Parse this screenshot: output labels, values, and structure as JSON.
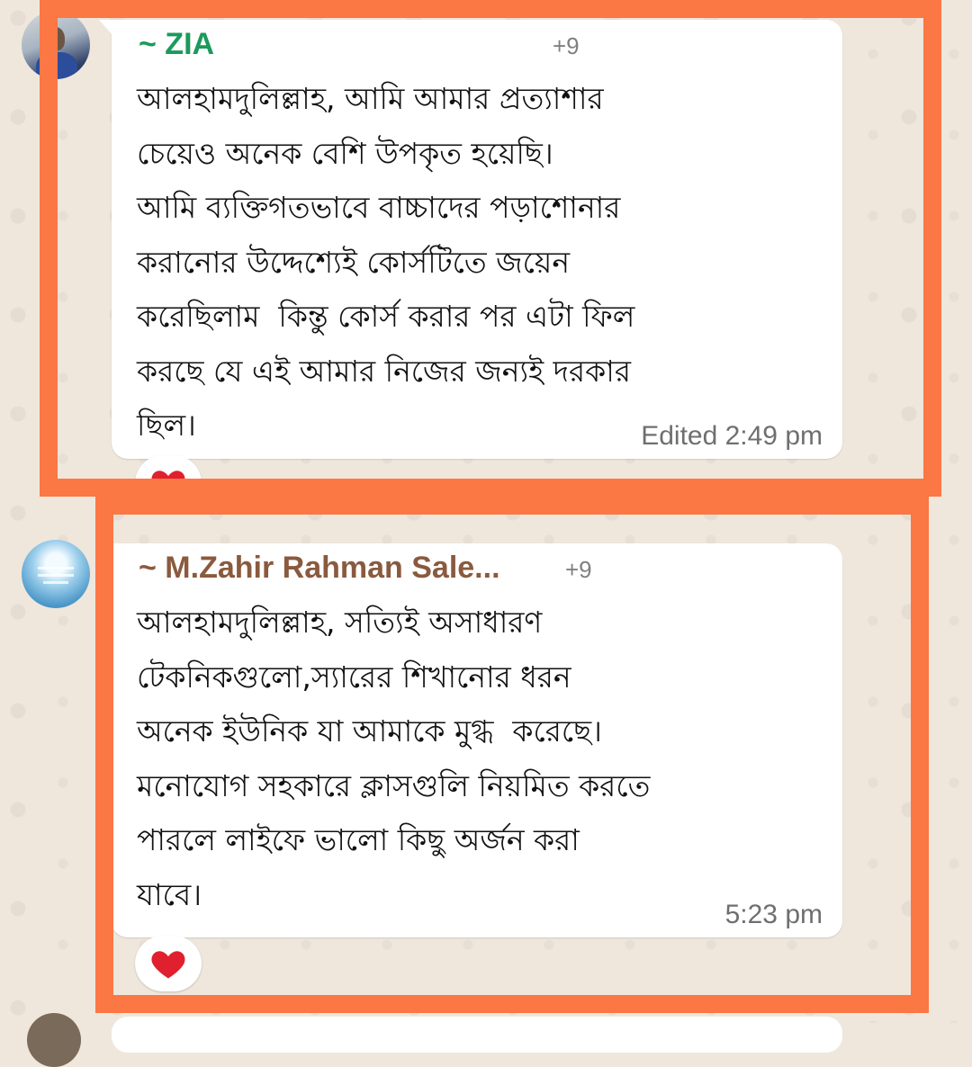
{
  "messages": [
    {
      "sender": "~ ZIA",
      "phone": "+9",
      "text": "আলহামদুলিল্লাহ, আমি আমার প্রত্যাশার\nচেয়েও অনেক বেশি উপকৃত হয়েছি।\nআমি ব্যক্তিগতভাবে বাচ্চাদের পড়াশোনার\nকরানোর উদ্দেশ্যেই কোর্সটিতে জয়েন\nকরেছিলাম  কিন্তু কোর্স করার পর এটা ফিল\nকরছে যে এই আমার নিজের জন্যই দরকার\nছিল।",
      "meta": "Edited 2:49 pm",
      "reaction": "❤️"
    },
    {
      "sender": "~ M.Zahir Rahman Sale...",
      "phone": "+9",
      "text": "আলহামদুলিল্লাহ, সত্যিই অসাধারণ\nটেকনিকগুলো,স্যারের শিখানোর ধরন\nঅনেক ইউনিক যা আমাকে মুগ্ধ  করেছে।\nমনোযোগ সহকারে ক্লাসগুলি নিয়মিত করতে\nপারলে লাইফে ভালো কিছু অর্জন করা\nযাবে।",
      "meta": "5:23 pm",
      "reaction": "❤️"
    }
  ],
  "colors": {
    "highlight": "#fb7744",
    "sender_1": "#1b9a5b",
    "sender_2": "#8a5a3e",
    "wallpaper": "#efe7dc"
  },
  "icons": {
    "reaction": "heart-icon"
  }
}
